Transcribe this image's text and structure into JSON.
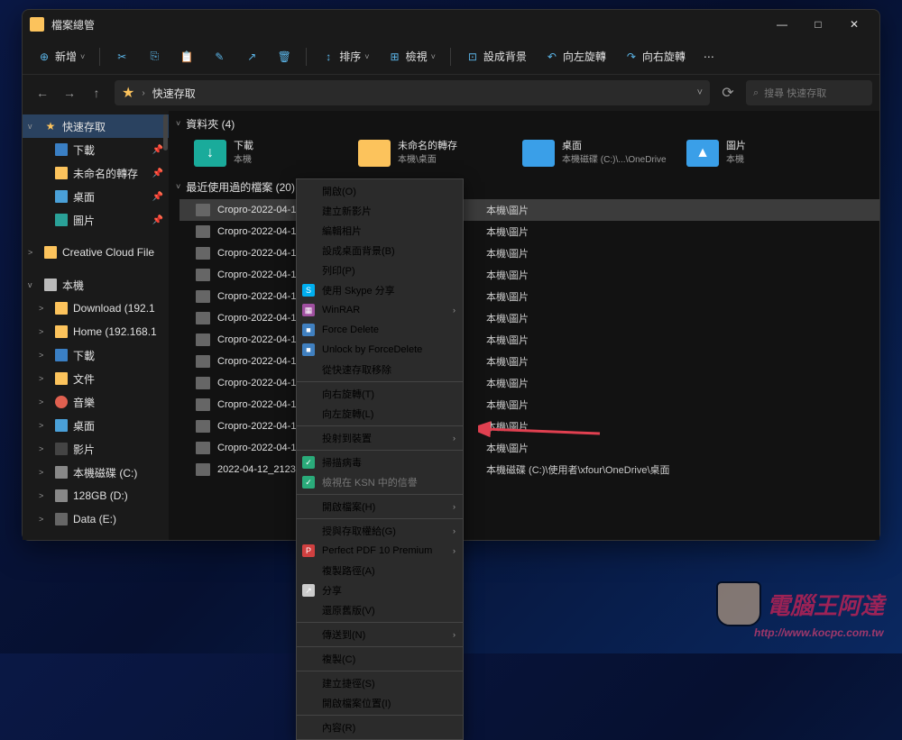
{
  "window": {
    "title": "檔案總管",
    "minimize": "—",
    "maximize": "□",
    "close": "✕"
  },
  "toolbar": {
    "new": "新增",
    "sort": "排序",
    "view": "檢視",
    "setBg": "設成背景",
    "rotateLeft": "向左旋轉",
    "rotateRight": "向右旋轉"
  },
  "addr": {
    "path": "快速存取",
    "searchPh": "搜尋 快速存取"
  },
  "sidebar": [
    {
      "label": "快速存取",
      "icon": "star",
      "exp": "v",
      "selected": true
    },
    {
      "label": "下載",
      "icon": "fold-blue",
      "indent": 1,
      "pin": true
    },
    {
      "label": "未命名的轉存",
      "icon": "fold-yel",
      "indent": 1,
      "pin": true
    },
    {
      "label": "桌面",
      "icon": "fold-dsk",
      "indent": 1,
      "pin": true
    },
    {
      "label": "圖片",
      "icon": "fold-cyan",
      "indent": 1,
      "pin": true
    },
    {
      "label": "Creative Cloud File",
      "icon": "fold-yel",
      "exp": ">"
    },
    {
      "label": "本機",
      "icon": "fold-pc",
      "exp": "v"
    },
    {
      "label": "Download (192.1",
      "icon": "fold-yel",
      "exp": ">",
      "indent": 1
    },
    {
      "label": "Home (192.168.1",
      "icon": "fold-yel",
      "exp": ">",
      "indent": 1
    },
    {
      "label": "下載",
      "icon": "fold-blue",
      "exp": ">",
      "indent": 1
    },
    {
      "label": "文件",
      "icon": "fold-yel",
      "exp": ">",
      "indent": 1
    },
    {
      "label": "音樂",
      "icon": "fold-music",
      "exp": ">",
      "indent": 1
    },
    {
      "label": "桌面",
      "icon": "fold-dsk",
      "exp": ">",
      "indent": 1
    },
    {
      "label": "影片",
      "icon": "fold-video",
      "exp": ">",
      "indent": 1
    },
    {
      "label": "本機磁碟 (C:)",
      "icon": "fold-drive",
      "exp": ">",
      "indent": 1
    },
    {
      "label": "128GB (D:)",
      "icon": "fold-drive",
      "exp": ">",
      "indent": 1
    },
    {
      "label": "Data (E:)",
      "icon": "fold-camera",
      "exp": ">",
      "indent": 1
    }
  ],
  "sections": {
    "folders": "資料夾 (4)",
    "recent": "最近使用過的檔案 (20)"
  },
  "folders": [
    {
      "name": "下載",
      "sub": "本機",
      "color": "#1aab9b",
      "glyph": "↓"
    },
    {
      "name": "未命名的轉存",
      "sub": "本機\\桌面",
      "color": "#fcc35c",
      "glyph": ""
    },
    {
      "name": "桌面",
      "sub": "本機磁碟 (C:)\\...\\OneDrive",
      "color": "#3a9fe8",
      "glyph": ""
    },
    {
      "name": "圖片",
      "sub": "本機",
      "color": "#3a9fe8",
      "glyph": "▲"
    }
  ],
  "files": [
    {
      "name": "Cropro-2022-04-13-09",
      "loc": "本機\\圖片",
      "selected": true
    },
    {
      "name": "Cropro-2022-04-13-09",
      "loc": "本機\\圖片"
    },
    {
      "name": "Cropro-2022-04-13-09",
      "loc": "本機\\圖片"
    },
    {
      "name": "Cropro-2022-04-13-09",
      "loc": "本機\\圖片"
    },
    {
      "name": "Cropro-2022-04-13-09",
      "loc": "本機\\圖片"
    },
    {
      "name": "Cropro-2022-04-13-09",
      "loc": "本機\\圖片"
    },
    {
      "name": "Cropro-2022-04-13-09",
      "loc": "本機\\圖片"
    },
    {
      "name": "Cropro-2022-04-13-09",
      "loc": "本機\\圖片"
    },
    {
      "name": "Cropro-2022-04-13-09",
      "loc": "本機\\圖片"
    },
    {
      "name": "Cropro-2022-04-13-08",
      "loc": "本機\\圖片"
    },
    {
      "name": "Cropro-2022-04-13-08",
      "loc": "本機\\圖片"
    },
    {
      "name": "Cropro-2022-04-13-08",
      "loc": "本機\\圖片"
    },
    {
      "name": "2022-04-12_212338",
      "loc": "本機磁碟 (C:)\\使用者\\xfour\\OneDrive\\桌面"
    }
  ],
  "contextMenu": [
    {
      "label": "開啟(O)"
    },
    {
      "label": "建立新影片"
    },
    {
      "label": "編輯相片"
    },
    {
      "label": "設成桌面背景(B)"
    },
    {
      "label": "列印(P)"
    },
    {
      "label": "使用 Skype 分享",
      "icon": "S",
      "iconColor": "#00aff0"
    },
    {
      "label": "WinRAR",
      "icon": "▦",
      "iconColor": "#a050a0",
      "sub": true
    },
    {
      "label": "Force Delete",
      "icon": "■",
      "iconColor": "#4080c0"
    },
    {
      "label": "Unlock by ForceDelete",
      "icon": "■",
      "iconColor": "#4080c0"
    },
    {
      "label": "從快速存取移除"
    },
    {
      "sep": true
    },
    {
      "label": "向右旋轉(T)"
    },
    {
      "label": "向左旋轉(L)"
    },
    {
      "sep": true
    },
    {
      "label": "投射到裝置",
      "sub": true
    },
    {
      "sep": true
    },
    {
      "label": "掃描病毒",
      "icon": "✓",
      "iconColor": "#2aab7a"
    },
    {
      "label": "檢視在 KSN 中的信譽",
      "icon": "✓",
      "iconColor": "#2aab7a",
      "disabled": true
    },
    {
      "sep": true
    },
    {
      "label": "開啟檔案(H)",
      "sub": true
    },
    {
      "sep": true
    },
    {
      "label": "授與存取權給(G)",
      "sub": true
    },
    {
      "label": "Perfect PDF 10 Premium",
      "icon": "P",
      "iconColor": "#d04040",
      "sub": true
    },
    {
      "label": "複製路徑(A)"
    },
    {
      "label": "分享",
      "icon": "↗",
      "iconColor": "#ccc"
    },
    {
      "label": "還原舊版(V)"
    },
    {
      "sep": true
    },
    {
      "label": "傳送到(N)",
      "sub": true
    },
    {
      "sep": true
    },
    {
      "label": "複製(C)"
    },
    {
      "sep": true
    },
    {
      "label": "建立捷徑(S)"
    },
    {
      "label": "開啟檔案位置(I)"
    },
    {
      "sep": true
    },
    {
      "label": "內容(R)"
    }
  ],
  "watermark": {
    "text": "電腦王阿達",
    "url": "http://www.kocpc.com.tw"
  }
}
